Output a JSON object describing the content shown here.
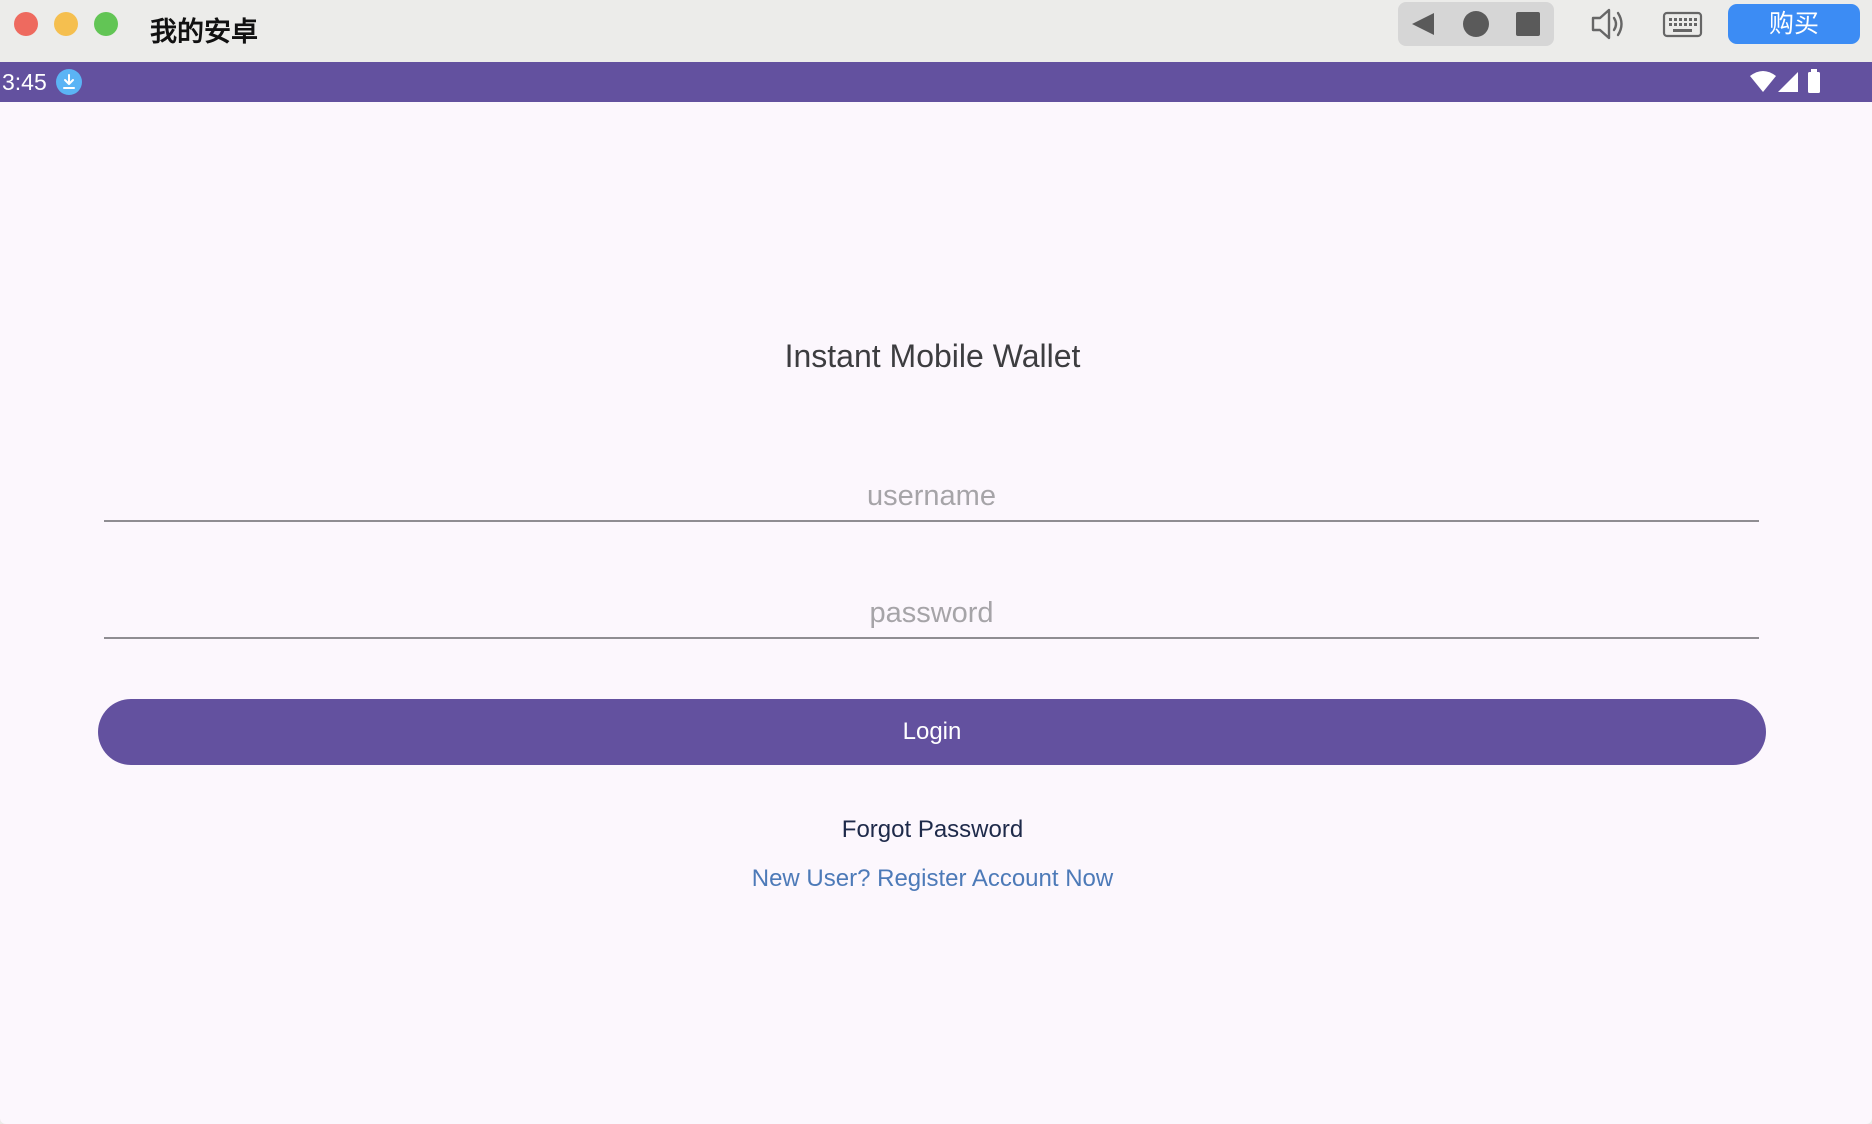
{
  "window": {
    "title": "我的安卓",
    "buy_label": "购买",
    "nav_icons": [
      "back-icon",
      "home-icon",
      "recents-icon"
    ],
    "toolbar_icons": [
      "volume-icon",
      "keyboard-icon"
    ]
  },
  "status_bar": {
    "time": "3:45",
    "icons": [
      "download-icon",
      "wifi-icon",
      "signal-icon",
      "battery-icon"
    ]
  },
  "app": {
    "title": "Instant Mobile Wallet",
    "username_placeholder": "username",
    "password_placeholder": "password",
    "login_label": "Login",
    "forgot_label": "Forgot Password",
    "register_label": "New User? Register Account Now"
  },
  "colors": {
    "primary": "#63519f",
    "background": "#fcf7fd",
    "link": "#4d7ab8",
    "buy_button": "#3c8cf4"
  }
}
